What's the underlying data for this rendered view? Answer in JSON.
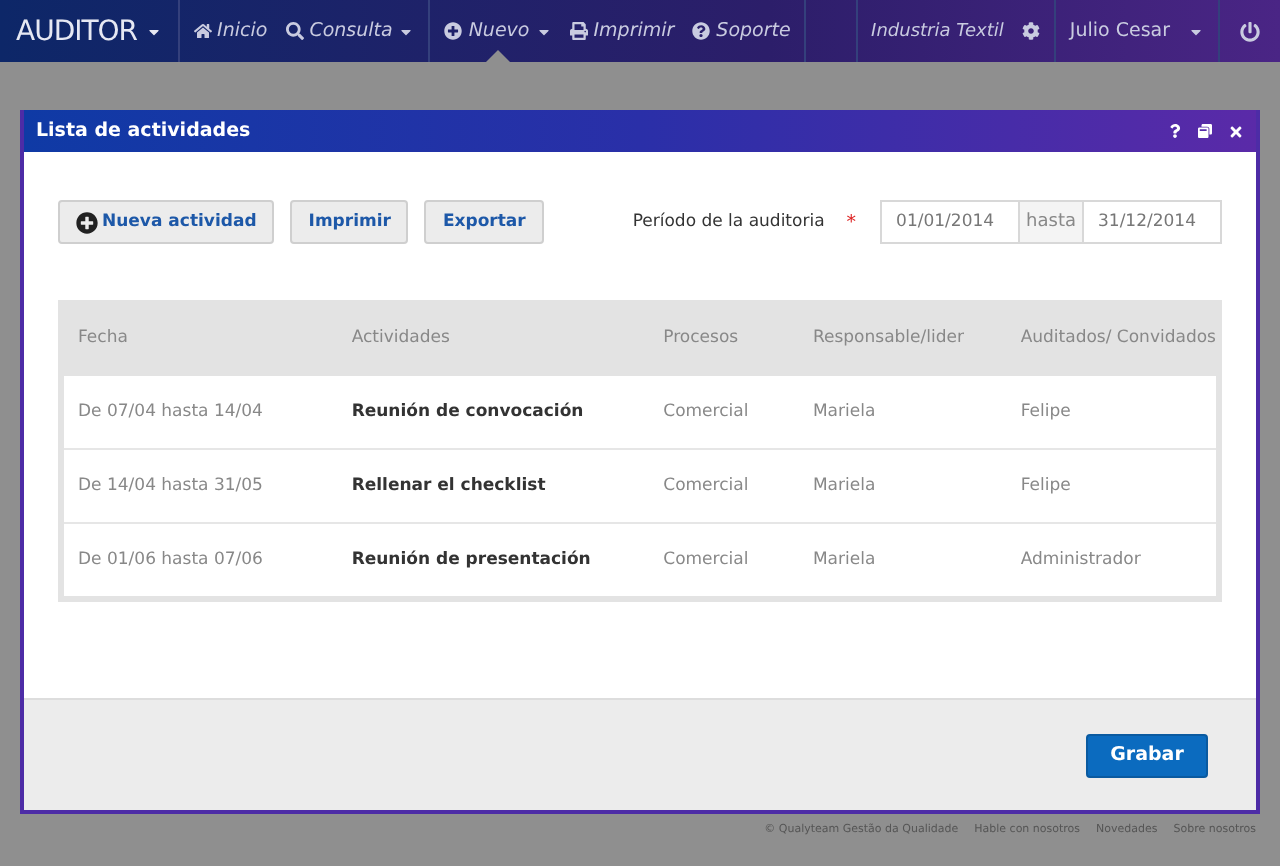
{
  "navbar": {
    "brand": "AUDITOR",
    "items": [
      {
        "label": "Inicio",
        "selected": false
      },
      {
        "label": "Consulta",
        "selected": false
      },
      {
        "label": "Nuevo",
        "selected": true
      },
      {
        "label": "Imprimir",
        "selected": false
      },
      {
        "label": "Soporte",
        "selected": false
      }
    ],
    "company": "Industria Textil",
    "user": "Julio Cesar"
  },
  "dialog": {
    "title": "Lista de actividades",
    "buttons": [
      {
        "label": "Nueva actividad"
      },
      {
        "label": "Imprimir"
      },
      {
        "label": "Exportar"
      }
    ],
    "period": {
      "label": "Período de la auditoria",
      "required_mark": "*",
      "from": "01/01/2014",
      "separator": "hasta",
      "to": "31/12/2014"
    },
    "table": {
      "columns": [
        "Fecha",
        "Actividades",
        "Procesos",
        "Responsable/lider",
        "Auditados/ Convidados"
      ],
      "rows": [
        [
          "De 07/04 hasta 14/04",
          "Reunión de convocación",
          "Comercial",
          "Mariela",
          "Felipe"
        ],
        [
          "De 14/04 hasta 31/05",
          "Rellenar el checklist",
          "Comercial",
          "Mariela",
          "Felipe"
        ],
        [
          "De 01/06 hasta 07/06",
          "Reunión de presentación",
          "Comercial",
          "Mariela",
          "Administrador"
        ]
      ]
    },
    "save_button": "Grabar"
  },
  "footer": [
    "© Qualyteam Gestão da Qualidade",
    "Hable con nosotros",
    "Novedades",
    "Sobre nosotros"
  ]
}
